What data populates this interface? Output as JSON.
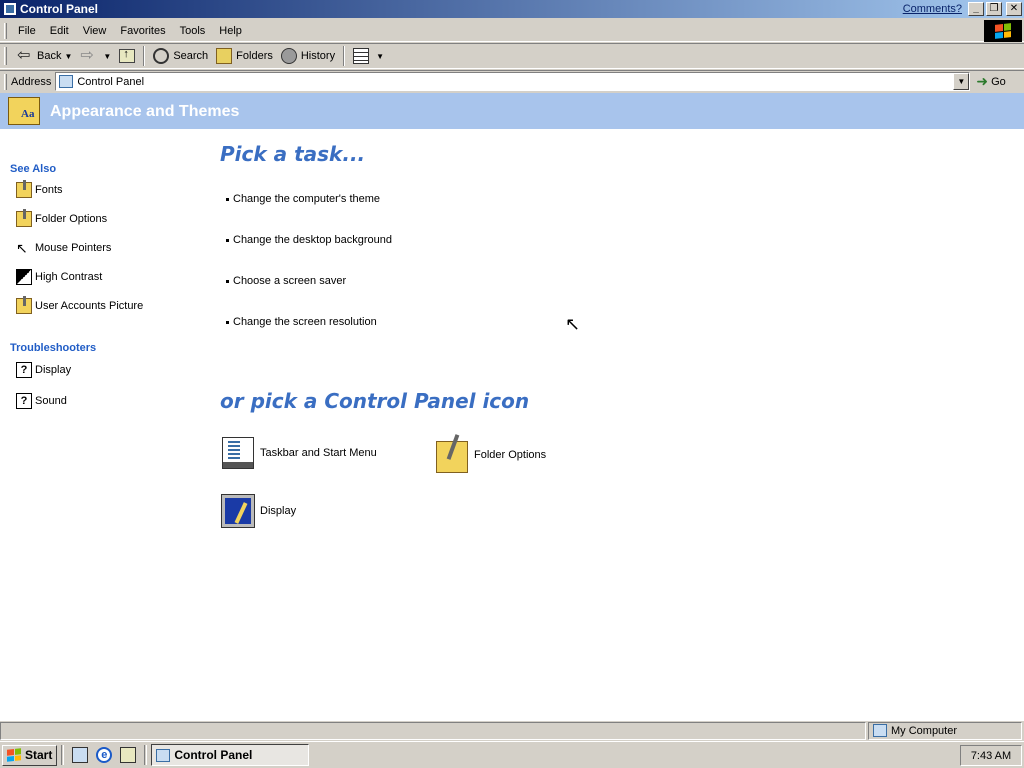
{
  "window": {
    "title": "Control Panel",
    "comments_link": "Comments?",
    "min_glyph": "_",
    "max_glyph": "❐",
    "close_glyph": "✕"
  },
  "menu": {
    "items": [
      "File",
      "Edit",
      "View",
      "Favorites",
      "Tools",
      "Help"
    ]
  },
  "toolbar": {
    "back": "Back",
    "search": "Search",
    "folders": "Folders",
    "history": "History",
    "dropdown_glyph": "▼"
  },
  "address": {
    "label": "Address",
    "value": "Control Panel",
    "go": "Go",
    "dropdown_glyph": "▼"
  },
  "banner": {
    "title": "Appearance and Themes"
  },
  "see_also": {
    "heading": "See Also",
    "items": [
      "Fonts",
      "Folder Options",
      "Mouse Pointers",
      "High Contrast",
      "User Accounts Picture"
    ]
  },
  "troubleshooters": {
    "heading": "Troubleshooters",
    "items": [
      "Display",
      "Sound"
    ]
  },
  "tasks": {
    "heading": "Pick a task...",
    "items": [
      "Change the computer's theme",
      "Change the desktop background",
      "Choose a screen saver",
      "Change the screen resolution"
    ]
  },
  "icons": {
    "heading": "or pick a Control Panel icon",
    "items": [
      "Taskbar and Start Menu",
      "Folder Options",
      "Display"
    ]
  },
  "statusbar": {
    "zone": "My Computer"
  },
  "taskbar": {
    "start": "Start",
    "window_button": "Control Panel",
    "clock": "7:43 AM",
    "ie_glyph": "e"
  }
}
